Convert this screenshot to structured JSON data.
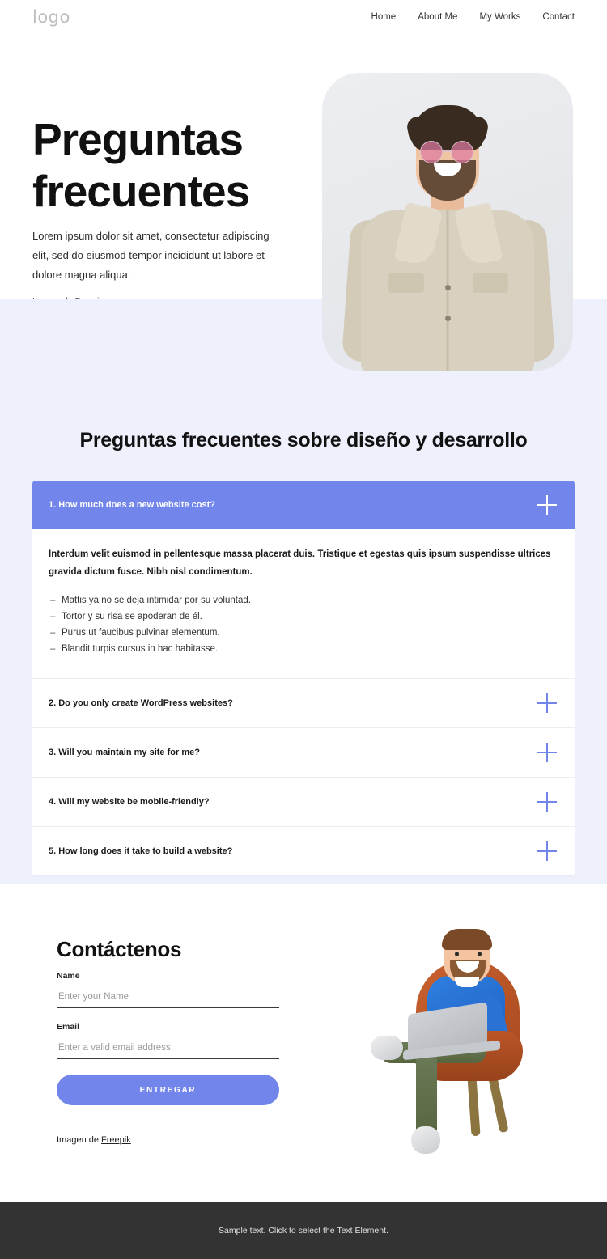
{
  "header": {
    "logo": "logo",
    "nav": [
      {
        "label": "Home"
      },
      {
        "label": "About Me"
      },
      {
        "label": "My Works"
      },
      {
        "label": "Contact"
      }
    ]
  },
  "hero": {
    "title": "Preguntas\nfrecuentes",
    "subtitle": "Lorem ipsum dolor sit amet, consectetur adipiscing elit, sed do eiusmod tempor incididunt ut labore et dolore magna aliqua.",
    "credit_prefix": "Imagen de ",
    "credit_link": "Freepik",
    "image_alt": "smiling-man-pink-sunglasses-beige-denim-jacket"
  },
  "faq": {
    "heading": "Preguntas frecuentes sobre diseño y desarrollo",
    "accent_color": "#7285eb",
    "section_bg": "#eef0fc",
    "items": [
      {
        "question": "1. How much does a new website cost?",
        "open": true,
        "lead": "Interdum velit euismod in pellentesque massa placerat duis. Tristique et egestas quis ipsum suspendisse ultrices gravida dictum fusce. Nibh nisl condimentum.",
        "bullets": [
          "Mattis ya no se deja intimidar por su voluntad.",
          "Tortor y su risa se apoderan de él.",
          "Purus ut faucibus pulvinar elementum.",
          "Blandit turpis cursus in hac habitasse."
        ]
      },
      {
        "question": "2. Do you only create WordPress websites?",
        "open": false
      },
      {
        "question": "3. Will you maintain my site for me?",
        "open": false
      },
      {
        "question": "4. Will my website be mobile-friendly?",
        "open": false
      },
      {
        "question": "5. How long does it take to build a website?",
        "open": false
      }
    ]
  },
  "contact": {
    "title": "Contáctenos",
    "name_label": "Name",
    "name_placeholder": "Enter your Name",
    "name_value": "",
    "email_label": "Email",
    "email_placeholder": "Enter a valid email address",
    "email_value": "",
    "submit_label": "ENTREGAR",
    "credit_prefix": "Imagen de ",
    "credit_link": "Freepik",
    "illustration_alt": "3d-man-blue-sweater-with-laptop-on-orange-chair"
  },
  "footer": {
    "text": "Sample text. Click to select the Text Element.",
    "bg": "#333333"
  }
}
